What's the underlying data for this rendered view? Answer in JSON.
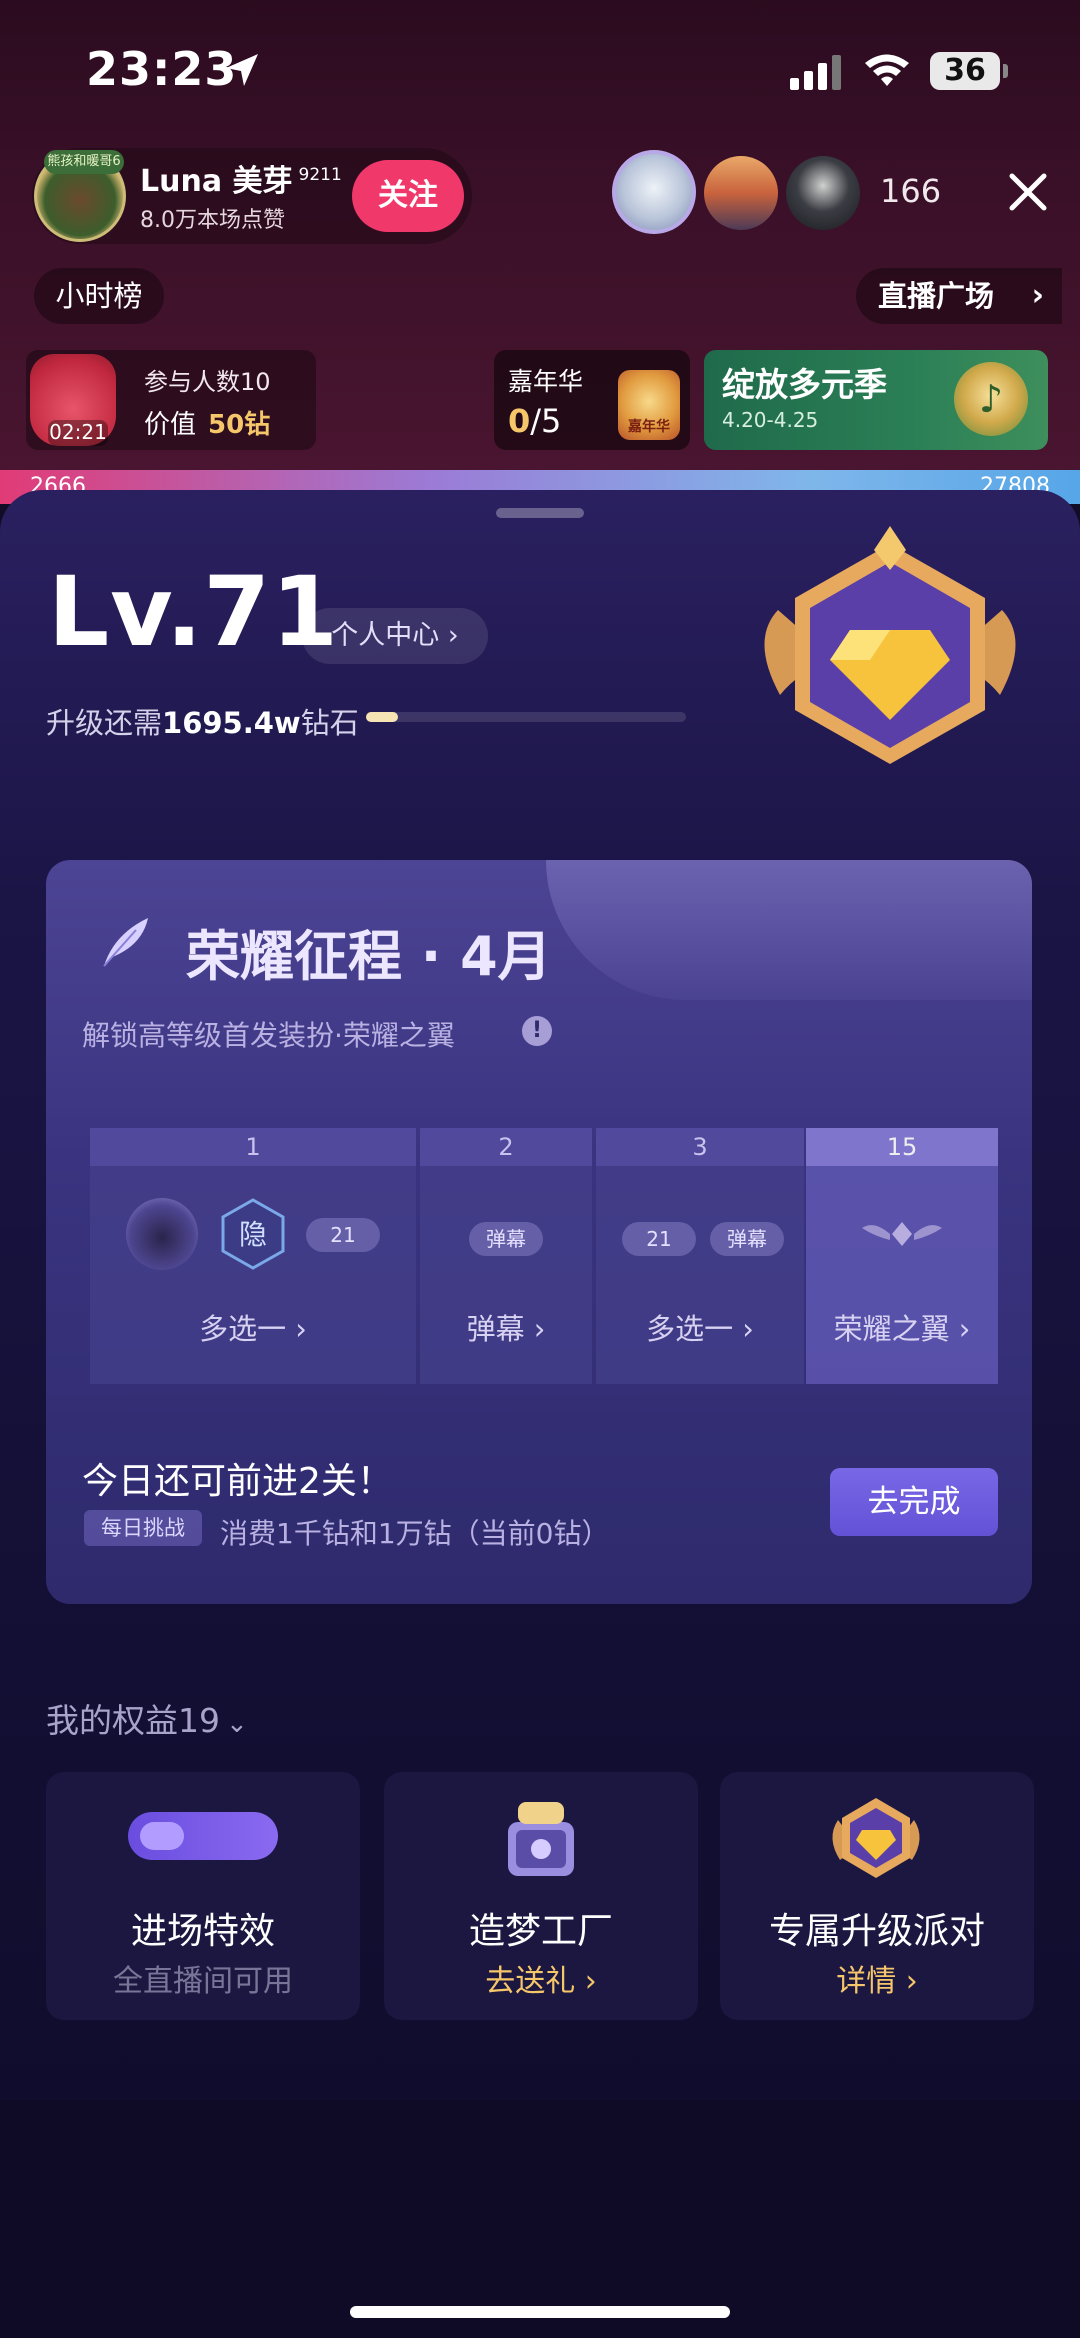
{
  "status": {
    "time": "23:23",
    "battery": "36"
  },
  "host": {
    "name": "Luna 美芽",
    "level": "9211",
    "likes": "8.0万本场点赞",
    "badge_text": "熊孩和暖哥6",
    "follow_label": "关注"
  },
  "viewers": {
    "count": "166"
  },
  "top_nav": {
    "rank_label": "小时榜",
    "plaza_label": "直播广场",
    "plaza_chevron": "›"
  },
  "red_bag": {
    "timer": "02:21",
    "participants": "参与人数10",
    "value_label": "价值",
    "value_amount": "50钻"
  },
  "carnival": {
    "label": "嘉年华",
    "progress_current": "0",
    "progress_total": "/5",
    "icon_text": "嘉年华"
  },
  "season": {
    "title": "绽放多元季",
    "dates": "4.20-4.25",
    "icon": "♪"
  },
  "pk": {
    "left_score": "2666",
    "right_score": "27808"
  },
  "level": {
    "label": "Lv.71",
    "center_button": "个人中心 ›",
    "upgrade_prefix": "升级还需",
    "upgrade_amount": "1695.4w",
    "upgrade_suffix": "钻石",
    "progress_fraction": 0.1
  },
  "glory": {
    "title": "荣耀征程 · 4月",
    "subtitle": "解锁高等级首发装扮·荣耀之翼",
    "info_icon": "!",
    "stages": [
      {
        "num": "1",
        "label": "多选一 ›",
        "chip": "21"
      },
      {
        "num": "2",
        "label": "弹幕 ›",
        "chip": "弹幕"
      },
      {
        "num": "3",
        "label": "多选一 ›",
        "chip_a": "21",
        "chip_b": "弹幕"
      },
      {
        "num": "15",
        "label": "荣耀之翼 ›"
      }
    ],
    "hidden_char": "隐",
    "today": "今日还可前进2关！",
    "daily_tag": "每日挑战",
    "daily_text": "消费1千钻和1万钻（当前0钻）",
    "go_button": "去完成"
  },
  "rights": {
    "title": "我的权益19",
    "chevron": "⌄",
    "cards": [
      {
        "title": "进场特效",
        "sub": "全直播间可用"
      },
      {
        "title": "造梦工厂",
        "sub": "去送礼 ›"
      },
      {
        "title": "专属升级派对",
        "sub": "详情 ›"
      }
    ]
  },
  "colors": {
    "accent": "#6352d6",
    "follow": "#f0386b",
    "gold": "#f6c76a"
  }
}
